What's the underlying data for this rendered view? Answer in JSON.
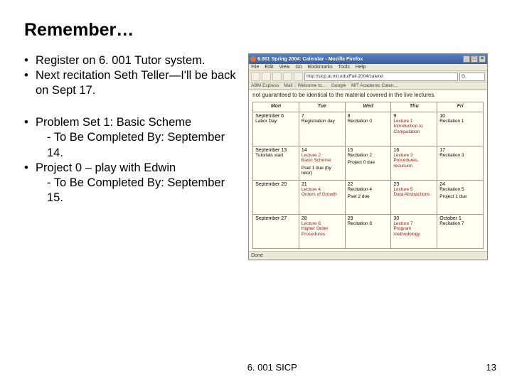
{
  "title": "Remember…",
  "bullets": {
    "b1": "Register on 6. 001 Tutor system.",
    "b2": "Next recitation Seth Teller—I'll be back on Sept 17.",
    "b3": "Problem Set 1: Basic Scheme",
    "b3a": "- To Be Completed By: September 14.",
    "b4": "Project 0 – play with Edwin",
    "b4a": "- To Be Completed By: September 15."
  },
  "browser": {
    "title": "6.001 Spring 2004: Calendar - Mozilla Firefox",
    "menu": {
      "file": "File",
      "edit": "Edit",
      "view": "View",
      "go": "Go",
      "bookmarks": "Bookmarks",
      "tools": "Tools",
      "help": "Help"
    },
    "url": "http://sicp.ai.mit.edu/Fall-2004/calend",
    "search_prefix": "G.",
    "linkbar": {
      "a": "ABM Express",
      "b": "Mail :: Welcome to…",
      "c": "Google",
      "d": "MIT Academic Calen…"
    },
    "warning": "not guaranteed to be identical to the material covered in the live lectures.",
    "headers": {
      "mon": "Mon",
      "tue": "Tue",
      "wed": "Wed",
      "thu": "Thu",
      "fri": "Fri"
    },
    "status": "Done"
  },
  "cal": {
    "w1": {
      "mon": {
        "date": "September 6",
        "ev": "Labor Day"
      },
      "tue": {
        "date": "7",
        "ev": "Registration day"
      },
      "wed": {
        "date": "8",
        "ev": "Recitation 0"
      },
      "thu": {
        "date": "9",
        "lec": "Lecture 1",
        "lec2": "Introduction to Computation"
      },
      "fri": {
        "date": "10",
        "ev": "Recitation 1"
      }
    },
    "w2": {
      "mon": {
        "date": "September 13",
        "ev": "Tutorials start"
      },
      "tue": {
        "date": "14",
        "lec": "Lecture 2",
        "lec2": "Basic Scheme",
        "ev": "Pset 1 due (by tutor)"
      },
      "wed": {
        "date": "15",
        "ev": "Recitation 2",
        "ev2": "Project 0 due"
      },
      "thu": {
        "date": "16",
        "lec": "Lecture 3",
        "lec2": "Procedures, recursion"
      },
      "fri": {
        "date": "17",
        "ev": "Recitation 3"
      }
    },
    "w3": {
      "mon": {
        "date": "September 20"
      },
      "tue": {
        "date": "21",
        "lec": "Lecture 4",
        "lec2": "Orders of Growth"
      },
      "wed": {
        "date": "22",
        "ev": "Recitation 4",
        "ev2": "Pset 2 due"
      },
      "thu": {
        "date": "23",
        "lec": "Lecture 5",
        "lec2": "Data Abstractions"
      },
      "fri": {
        "date": "24",
        "ev": "Recitation 5",
        "ev2": "Project 1 due"
      }
    },
    "w4": {
      "mon": {
        "date": "September 27"
      },
      "tue": {
        "date": "28",
        "lec": "Lecture 6",
        "lec2": "Higher Order Procedures"
      },
      "wed": {
        "date": "29",
        "ev": "Recitation 6"
      },
      "thu": {
        "date": "30",
        "lec": "Lecture 7",
        "lec2": "Program methodology"
      },
      "fri": {
        "date": "October 1",
        "ev": "Recitation 7"
      }
    }
  },
  "footer": {
    "center": "6. 001 SICP",
    "page": "13"
  }
}
